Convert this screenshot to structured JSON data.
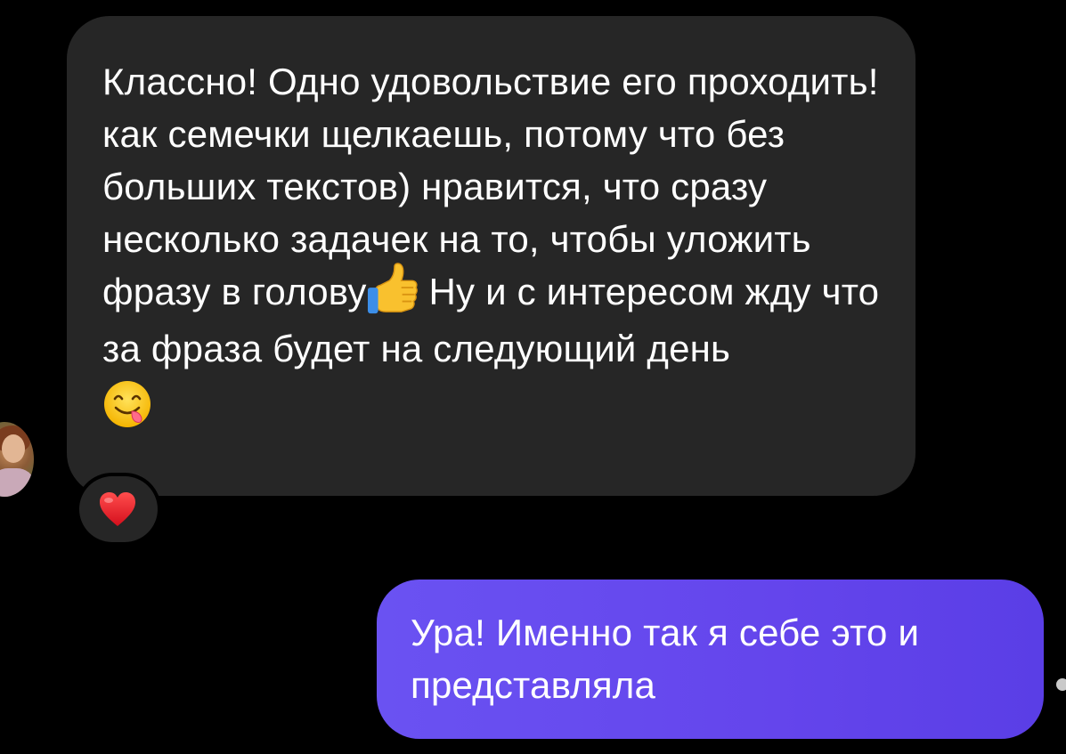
{
  "conversation": {
    "incoming_message": {
      "text_part1": "Классно! Одно удовольствие его проходить! как семечки щелкаешь, потому что без больших текстов) нравится, что сразу несколько задачек на то, чтобы уложить фразу в голову",
      "text_part2": " Ну и с интересом жду что за фраза будет на следующий день",
      "inline_emoji_1": "thumbs-up",
      "inline_emoji_2": "face-savoring-food",
      "bubble_color": "#262626",
      "reaction": "red-heart"
    },
    "outgoing_message": {
      "text": "Ура! Именно так я себе это и представляла",
      "bubble_color": "#6445ec"
    }
  }
}
